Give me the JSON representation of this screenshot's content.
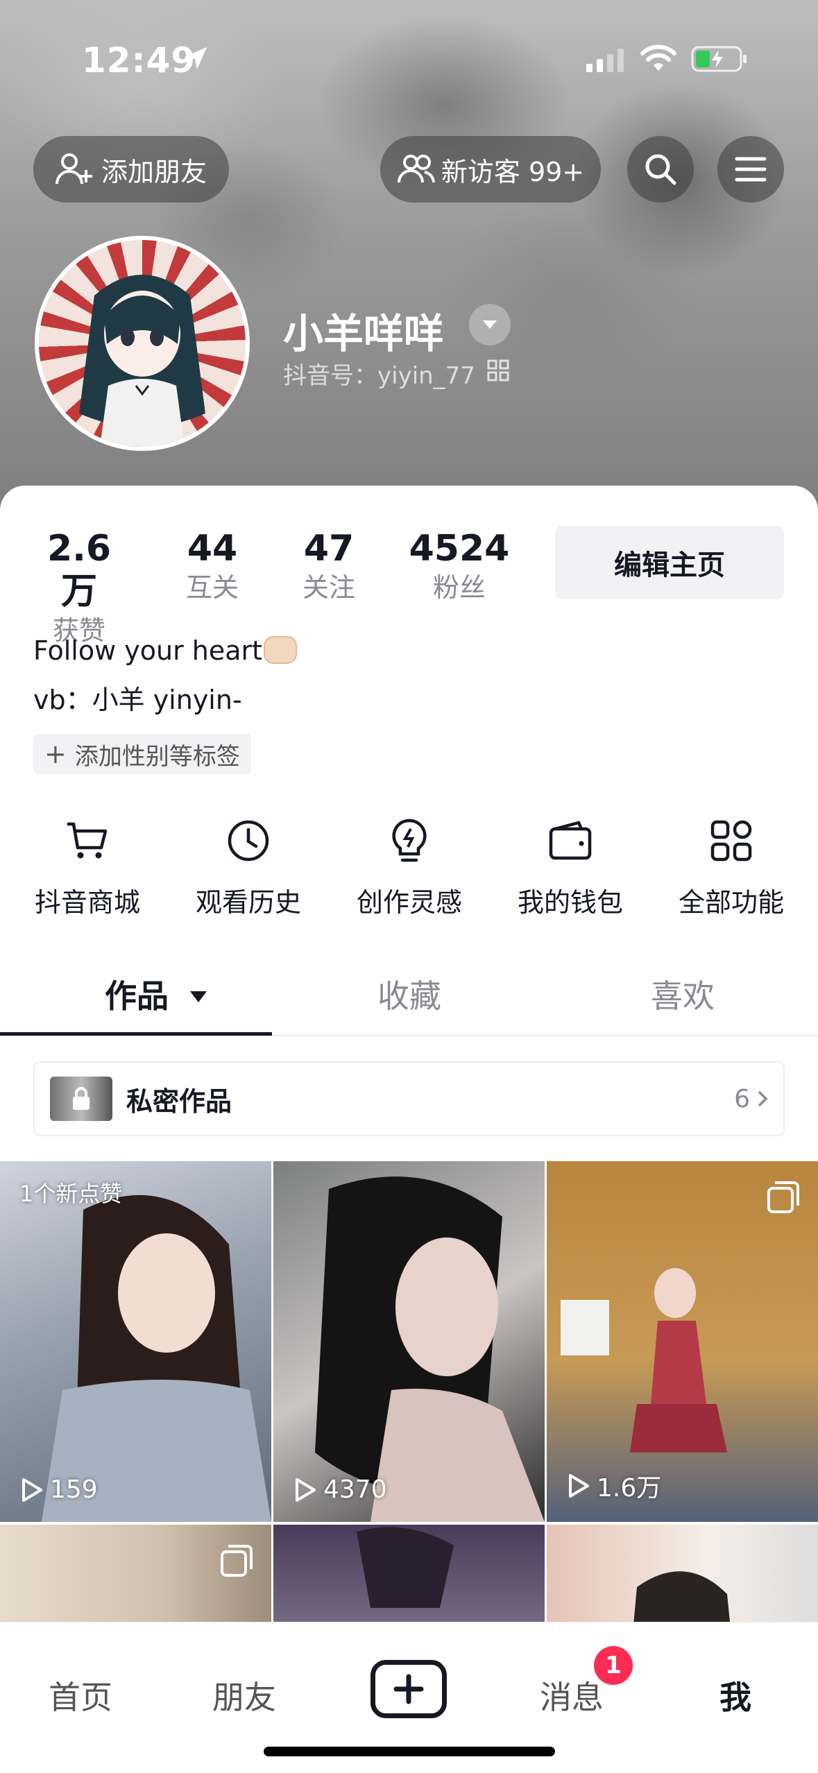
{
  "status_bar": {
    "time": "12:49"
  },
  "header": {
    "add_friend_label": "添加朋友",
    "visitors_label": "新访客 99+",
    "nickname": "小羊咩咩",
    "douyin_id": "抖音号：yiyin_77"
  },
  "stats": [
    {
      "value": "2.6万",
      "label": "获赞"
    },
    {
      "value": "44",
      "label": "互关"
    },
    {
      "value": "47",
      "label": "关注"
    },
    {
      "value": "4524",
      "label": "粉丝"
    }
  ],
  "edit_profile_label": "编辑主页",
  "bio": {
    "line1": "Follow your heart",
    "line2": "vb：小羊 yinyin-"
  },
  "add_tag_label": "添加性别等标签",
  "features": [
    {
      "label": "抖音商城",
      "icon": "cart-icon"
    },
    {
      "label": "观看历史",
      "icon": "clock-icon"
    },
    {
      "label": "创作灵感",
      "icon": "lightbulb-icon"
    },
    {
      "label": "我的钱包",
      "icon": "wallet-icon"
    },
    {
      "label": "全部功能",
      "icon": "grid-icon"
    }
  ],
  "tabs": {
    "works": "作品",
    "favorites": "收藏",
    "likes": "喜欢"
  },
  "private_works": {
    "label": "私密作品",
    "count": "6"
  },
  "videos": [
    {
      "views": "159",
      "badge": "1个新点赞"
    },
    {
      "views": "4370"
    },
    {
      "views": "1.6万"
    }
  ],
  "bottom_nav": {
    "home": "首页",
    "friends": "朋友",
    "messages": "消息",
    "messages_badge": "1",
    "me": "我"
  },
  "colors": {
    "accent": "#fe2c55",
    "text": "#161823",
    "muted": "#8a8b91"
  }
}
